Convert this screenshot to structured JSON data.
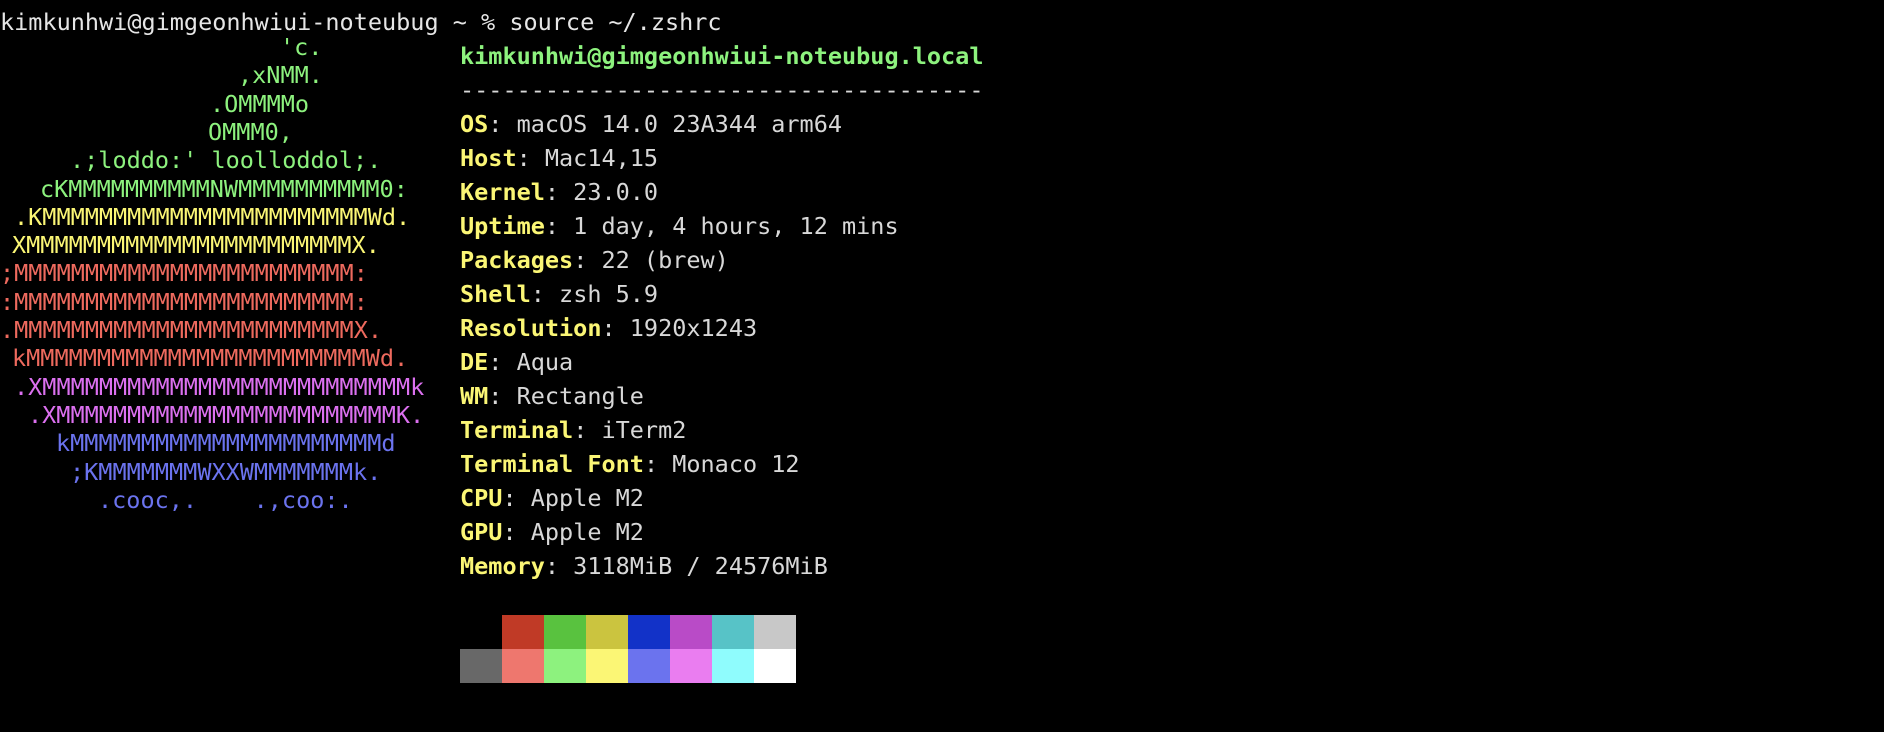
{
  "prompt": {
    "text": "kimkunhwi@gimgeonhwiui-noteubug ~ % source ~/.zshrc"
  },
  "logo": {
    "lines": [
      {
        "text": "'c.",
        "color": "#8df27e",
        "indent": 280
      },
      {
        "text": ",xNMM.",
        "color": "#8df27e",
        "indent": 238
      },
      {
        "text": ".OMMMMo",
        "color": "#8df27e",
        "indent": 210
      },
      {
        "text": "OMMM0,",
        "color": "#8df27e",
        "indent": 208
      },
      {
        "text": ".;loddo:' loolloddol;.",
        "color": "#8df27e",
        "indent": 70
      },
      {
        "text": "cKMMMMMMMMMMNWMMMMMMMMMM0:",
        "color": "#8df27e",
        "indent": 40
      },
      {
        "text": ".KMMMMMMMMMMMMMMMMMMMMMMMWd.",
        "color": "#fbf675",
        "indent": 14
      },
      {
        "text": "XMMMMMMMMMMMMMMMMMMMMMMMX.",
        "color": "#fbf675",
        "indent": 12
      },
      {
        "text": ";MMMMMMMMMMMMMMMMMMMMMMMM:",
        "color": "#ee6a5e",
        "indent": 0
      },
      {
        "text": ":MMMMMMMMMMMMMMMMMMMMMMMM:",
        "color": "#ee6a5e",
        "indent": 0
      },
      {
        "text": ".MMMMMMMMMMMMMMMMMMMMMMMMX.",
        "color": "#ee6a5e",
        "indent": 0
      },
      {
        "text": "kMMMMMMMMMMMMMMMMMMMMMMMMWd.",
        "color": "#ee6a5e",
        "indent": 12
      },
      {
        "text": ".XMMMMMMMMMMMMMMMMMMMMMMMMMMk",
        "color": "#dc70f0",
        "indent": 14
      },
      {
        "text": ".XMMMMMMMMMMMMMMMMMMMMMMMMK.",
        "color": "#dc70f0",
        "indent": 28
      },
      {
        "text": "kMMMMMMMMMMMMMMMMMMMMMMd",
        "color": "#6b73ee",
        "indent": 56
      },
      {
        "text": ";KMMMMMMMWXXWMMMMMMMk.",
        "color": "#6b73ee",
        "indent": 70
      },
      {
        "text": ".cooc,.    .,coo:.",
        "color": "#6b73ee",
        "indent": 98
      }
    ]
  },
  "info": {
    "title": "kimkunhwi@gimgeonhwiui-noteubug.local",
    "separator": "-------------------------------------",
    "rows": [
      {
        "label": "OS",
        "value": ": macOS 14.0 23A344 arm64"
      },
      {
        "label": "Host",
        "value": ": Mac14,15"
      },
      {
        "label": "Kernel",
        "value": ": 23.0.0"
      },
      {
        "label": "Uptime",
        "value": ": 1 day, 4 hours, 12 mins"
      },
      {
        "label": "Packages",
        "value": ": 22 (brew)"
      },
      {
        "label": "Shell",
        "value": ": zsh 5.9"
      },
      {
        "label": "Resolution",
        "value": ": 1920x1243"
      },
      {
        "label": "DE",
        "value": ": Aqua"
      },
      {
        "label": "WM",
        "value": ": Rectangle"
      },
      {
        "label": "Terminal",
        "value": ": iTerm2"
      },
      {
        "label": "Terminal Font",
        "value": ": Monaco 12"
      },
      {
        "label": "CPU",
        "value": ": Apple M2"
      },
      {
        "label": "GPU",
        "value": ": Apple M2"
      },
      {
        "label": "Memory",
        "value": ": 3118MiB / 24576MiB"
      }
    ]
  },
  "palette": {
    "row1": [
      "#000000",
      "#c03a26",
      "#59c23f",
      "#cbc43f",
      "#1232c8",
      "#b94bc7",
      "#57c3c7",
      "#c8c8c8"
    ],
    "row2": [
      "#686868",
      "#ee776e",
      "#8df27e",
      "#fbf675",
      "#6b73ee",
      "#ea7df0",
      "#8ffcfd",
      "#ffffff"
    ]
  }
}
